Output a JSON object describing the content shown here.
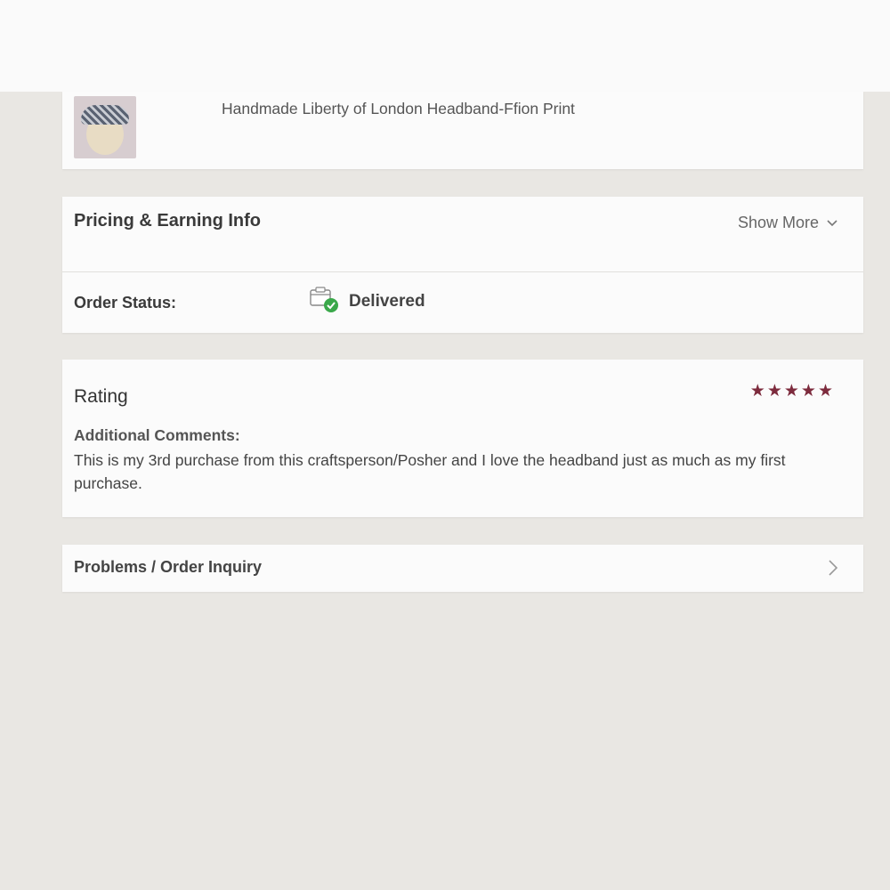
{
  "product": {
    "title": "Handmade Liberty of London Headband-Ffion Print"
  },
  "pricing": {
    "heading": "Pricing & Earning Info",
    "show_more_label": "Show More"
  },
  "order_status": {
    "label": "Order Status:",
    "value": "Delivered",
    "icon": "delivered-check-icon",
    "icon_color": "#3aa84a"
  },
  "rating": {
    "heading": "Rating",
    "stars_filled": 5,
    "stars_total": 5,
    "star_color": "#7d2b3d",
    "comments_label": "Additional Comments:",
    "comments_text": "This is my 3rd purchase from this craftsperson/Posher and I love the headband just as much as my first purchase."
  },
  "problems": {
    "label": "Problems / Order Inquiry"
  }
}
